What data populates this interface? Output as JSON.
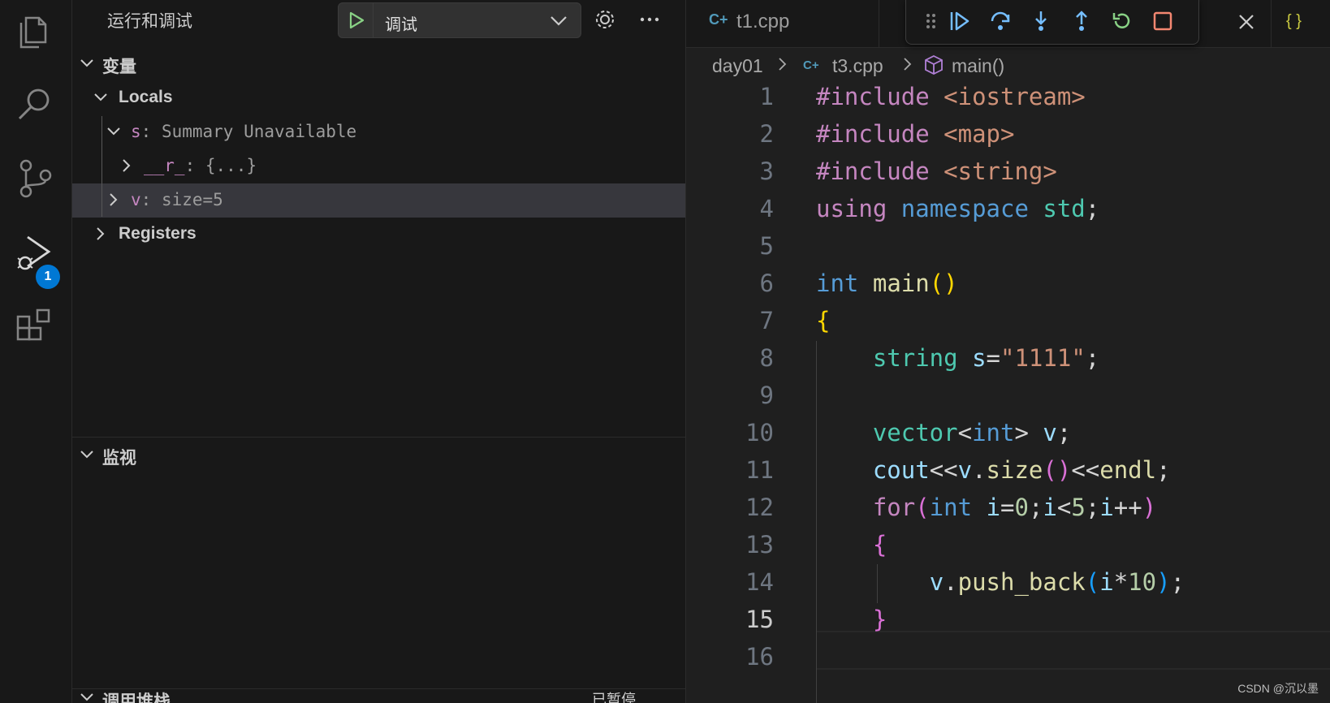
{
  "activity_bar": {
    "items": [
      "explorer-icon",
      "search-icon",
      "source-control-icon",
      "run-debug-icon",
      "extensions-icon"
    ],
    "debug_badge": "1",
    "accent": "#0078d4"
  },
  "sidebar": {
    "title": "运行和调试",
    "launch_config": "调试",
    "variables_header": "变量",
    "locals_label": "Locals",
    "vars": [
      {
        "name": "s",
        "value": "Summary Unavailable"
      },
      {
        "name": "__r_",
        "value": "{...}"
      },
      {
        "name": "v",
        "value": "size=5"
      }
    ],
    "registers_label": "Registers",
    "watch_header": "监视",
    "callstack_header": "调用堆栈",
    "callstack_status": "已暂停"
  },
  "tabs": [
    {
      "label": "t1.cpp"
    },
    {
      "label": "{ }"
    }
  ],
  "breadcrumb": {
    "folder": "day01",
    "file": "t3.cpp",
    "symbol": "main()"
  },
  "code": {
    "current_line": 15,
    "line_numbers": [
      "1",
      "2",
      "3",
      "4",
      "5",
      "6",
      "7",
      "8",
      "9",
      "10",
      "11",
      "12",
      "13",
      "14",
      "15",
      "16"
    ]
  },
  "watermark": "CSDN @沉以墨"
}
